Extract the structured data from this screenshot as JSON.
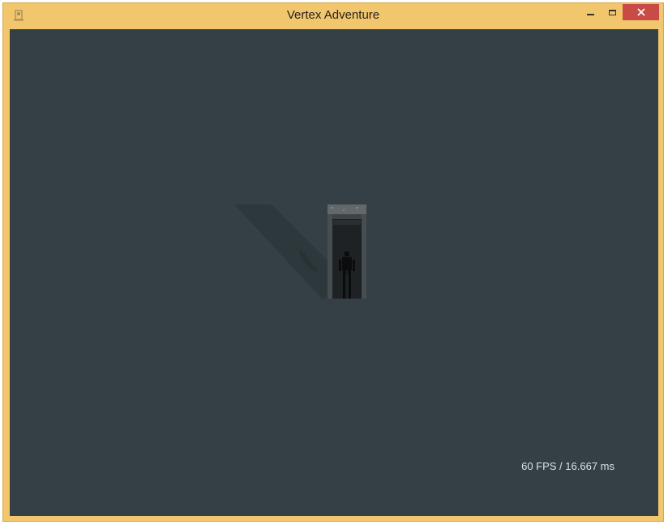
{
  "window": {
    "title": "Vertex Adventure",
    "icon": "app-icon",
    "controls": [
      "minimize-icon",
      "maximize-icon",
      "close-icon"
    ]
  },
  "game": {
    "background_color": "#344045",
    "fps_readout": "60 FPS / 16.667 ms",
    "scene_objects": [
      "stone-doorway",
      "player-silhouette",
      "cast-shadow"
    ]
  },
  "colors": {
    "title_bar": "#f2c66c",
    "close_button": "#c94b45",
    "text": "#dfe3e5"
  }
}
